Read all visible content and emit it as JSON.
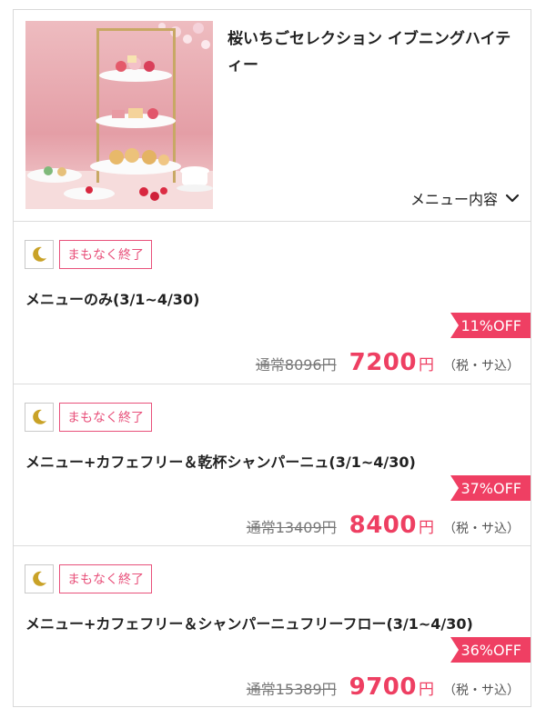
{
  "product": {
    "title": "桜いちごセレクション イブニングハイティー",
    "menu_link_label": "メニュー内容"
  },
  "plans": [
    {
      "tag": "まもなく終了",
      "name": "メニューのみ(3/1~4/30)",
      "discount": "11%OFF",
      "regular_price": "通常8096円",
      "price": "7200",
      "currency": "円",
      "tax_note": "（税・サ込）"
    },
    {
      "tag": "まもなく終了",
      "name": "メニュー+カフェフリー＆乾杯シャンパーニュ(3/1~4/30)",
      "discount": "37%OFF",
      "regular_price": "通常13409円",
      "price": "8400",
      "currency": "円",
      "tax_note": "（税・サ込）"
    },
    {
      "tag": "まもなく終了",
      "name": "メニュー+カフェフリー＆シャンパーニュフリーフロー(3/1~4/30)",
      "discount": "36%OFF",
      "regular_price": "通常15389円",
      "price": "9700",
      "currency": "円",
      "tax_note": "（税・サ込）"
    }
  ],
  "icons": {
    "moon": "moon-icon",
    "chevron": "chevron-down-icon"
  },
  "colors": {
    "accent": "#ee3f62",
    "tag_border": "#e8507a",
    "moon": "#c9a227"
  }
}
